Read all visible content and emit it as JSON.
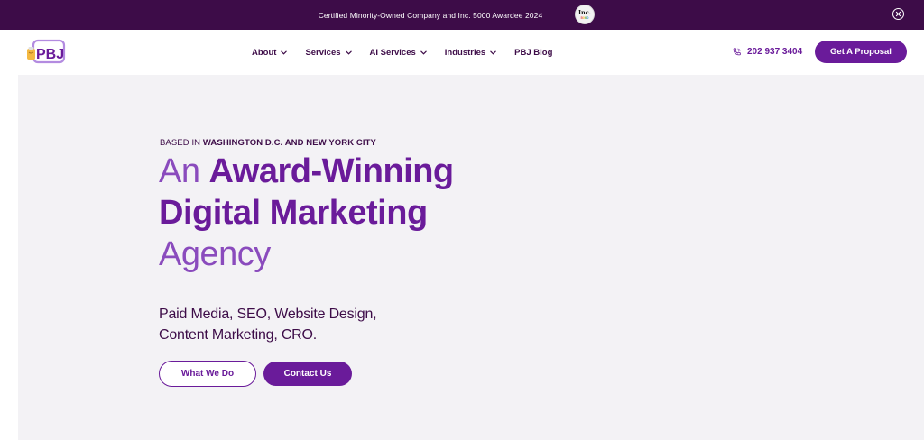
{
  "announcement": {
    "text": "Certified Minority-Owned Company and Inc. 5000 Awardee 2024",
    "badge_word": "Inc.",
    "badge_digits": [
      "5",
      "0",
      "0",
      "0"
    ]
  },
  "header": {
    "logo_text": "PBJ",
    "nav": [
      {
        "label": "About",
        "has_dropdown": true
      },
      {
        "label": "Services",
        "has_dropdown": true
      },
      {
        "label": "AI Services",
        "has_dropdown": true
      },
      {
        "label": "Industries",
        "has_dropdown": true
      },
      {
        "label": "PBJ Blog",
        "has_dropdown": false
      }
    ],
    "phone": "202 937 3404",
    "cta_label": "Get A Proposal"
  },
  "hero": {
    "eyebrow_prefix": "BASED IN ",
    "eyebrow_strong": "WASHINGTON D.C. AND NEW YORK CITY",
    "headline_an": "An ",
    "headline_bold_1": "Award-Winning",
    "headline_bold_2": "Digital Marketing",
    "headline_light_2": "Agency",
    "subline_1": "Paid Media, SEO, Website Design,",
    "subline_2": "Content Marketing, CRO.",
    "primary_button": "What We Do",
    "secondary_button": "Contact Us"
  },
  "colors": {
    "brand_dark": "#3d0c48",
    "brand_purple": "#6a1b9a",
    "hero_bg": "#f3f2f5"
  }
}
